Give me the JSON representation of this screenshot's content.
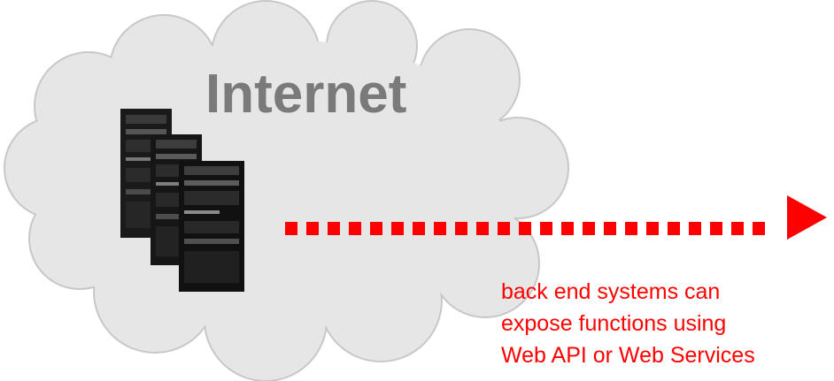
{
  "cloud": {
    "title": "Internet"
  },
  "caption": {
    "lines": [
      "back end systems can",
      "expose functions using",
      "Web API or Web Services"
    ]
  },
  "colors": {
    "cloud_fill": "#e6e6e6",
    "cloud_stroke": "#c8c8c8",
    "title": "#7a7a7a",
    "arrow": "#ff0000",
    "caption": "#ff0000",
    "rack": "#1a1a1a"
  },
  "icons": {
    "servers": "server-rack-icon",
    "arrow": "dotted-arrow-icon"
  }
}
